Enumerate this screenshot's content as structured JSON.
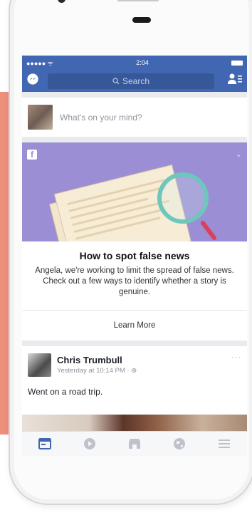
{
  "status": {
    "signal": "●●●●● ᯤ",
    "time": "2:04"
  },
  "nav": {
    "search_placeholder": "Search"
  },
  "composer": {
    "prompt": "What's on your mind?"
  },
  "card": {
    "chevron": "⌄",
    "title": "How to spot false news",
    "description": "Angela, we're working to limit the spread of false news. Check out a few ways to identify whether a story is genuine.",
    "cta": "Learn More"
  },
  "post": {
    "author": "Chris Trumbull",
    "time": "Yesterday at 10:14 PM · ⊕",
    "more": "···",
    "text": "Went on a road trip."
  },
  "colors": {
    "fb_blue": "#4267b2",
    "hero_purple": "#9b8ed4",
    "accent_coral": "#ec8f7d"
  },
  "icons": [
    "messenger-icon",
    "search-icon",
    "friend-requests-icon",
    "facebook-f-icon",
    "news-feed-icon",
    "video-icon",
    "marketplace-icon",
    "globe-icon",
    "menu-icon"
  ]
}
